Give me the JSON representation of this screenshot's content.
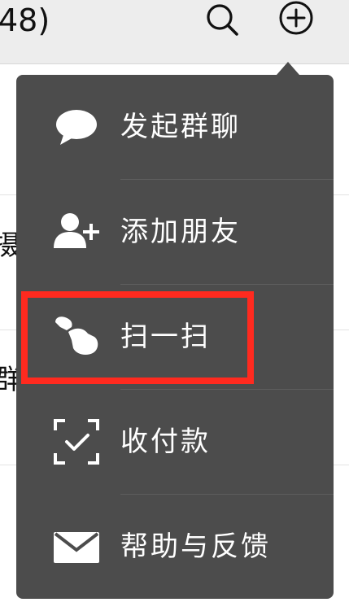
{
  "header": {
    "title_fragment": "48)",
    "search_icon": "search-icon",
    "add_icon": "plus-circle-icon"
  },
  "background_list": {
    "row1_fragment": "摄",
    "row2_fragment": "群"
  },
  "menu": {
    "items": [
      {
        "label": "发起群聊",
        "icon": "chat-bubble-icon"
      },
      {
        "label": "添加朋友",
        "icon": "add-friend-icon"
      },
      {
        "label": "扫一扫",
        "icon": "scan-icon"
      },
      {
        "label": "收付款",
        "icon": "payment-scan-icon"
      },
      {
        "label": "帮助与反馈",
        "icon": "envelope-icon"
      }
    ],
    "highlight_color": "#ff2a1f",
    "menu_bg": "#4c4c4c"
  }
}
